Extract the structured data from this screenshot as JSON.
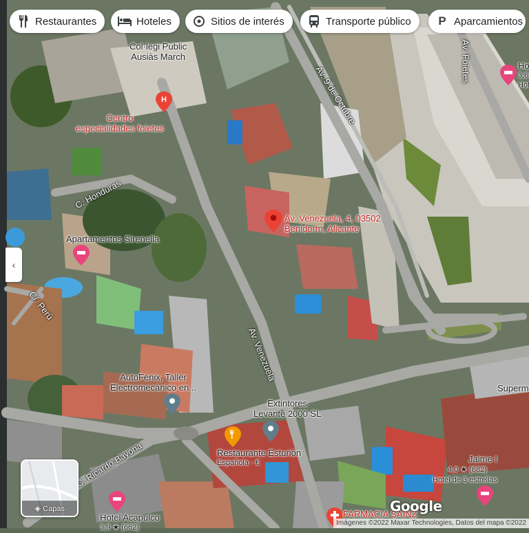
{
  "categories": [
    {
      "label": "Restaurantes",
      "icon": "restaurant-icon"
    },
    {
      "label": "Hoteles",
      "icon": "hotel-icon"
    },
    {
      "label": "Sitios de interés",
      "icon": "attraction-icon"
    },
    {
      "label": "Transporte público",
      "icon": "transit-icon"
    },
    {
      "label": "Aparcamientos",
      "icon": "parking-icon"
    }
  ],
  "places": {
    "school": "Col·legi Públic\nAusiàs March",
    "medical": "Centro\nespecialidades foietes",
    "apartments": "Apartamentos Sirenella",
    "selected_address_line1": "Av. Venezuela, 4, 03502",
    "selected_address_line2": "Benidorm, Alicante",
    "garage": "AutoFénix, Taller\nElectromecánico en...",
    "extinguishers": "Extintores\nLevante 2000 SL",
    "restaurant": "Restaurante Esturión",
    "restaurant_sub": "Española · €",
    "hotel_right_top_1": "Ho",
    "hotel_right_top_2": "3,6",
    "hotel_right_top_3": "Hot",
    "hotel_jaime": "Jaime I",
    "hotel_jaime_rating": "4,0 ★ (682)",
    "hotel_jaime_type": "Hotel de 3 estrellas",
    "hotel_acapulco": "Hotel Acapulco",
    "hotel_acapulco_sub": "3,9 ★ (662)",
    "pharmacy": "FARMACIA SAINZ",
    "supermarket": "Superm"
  },
  "streets": {
    "nueve_octubre": "Av. 9 de Octubre",
    "foietes": "Av. Foietes",
    "honduras": "C. Honduras",
    "peru": "C/. Perú",
    "venezuela": "Av. Venezuela",
    "ricardo_bayona": "C. Ricardo Bayona"
  },
  "controls": {
    "layers_label": "Capas",
    "collapse_glyph": "‹"
  },
  "branding": {
    "logo": "Google",
    "attribution": "Imágenes ©2022 Maxar Technologies, Datos del mapa ©2022"
  },
  "colors": {
    "pin_red": "#ea4335",
    "hotel_pink": "#e8457c",
    "place_gray": "#607d8b",
    "food_orange": "#f29900"
  }
}
